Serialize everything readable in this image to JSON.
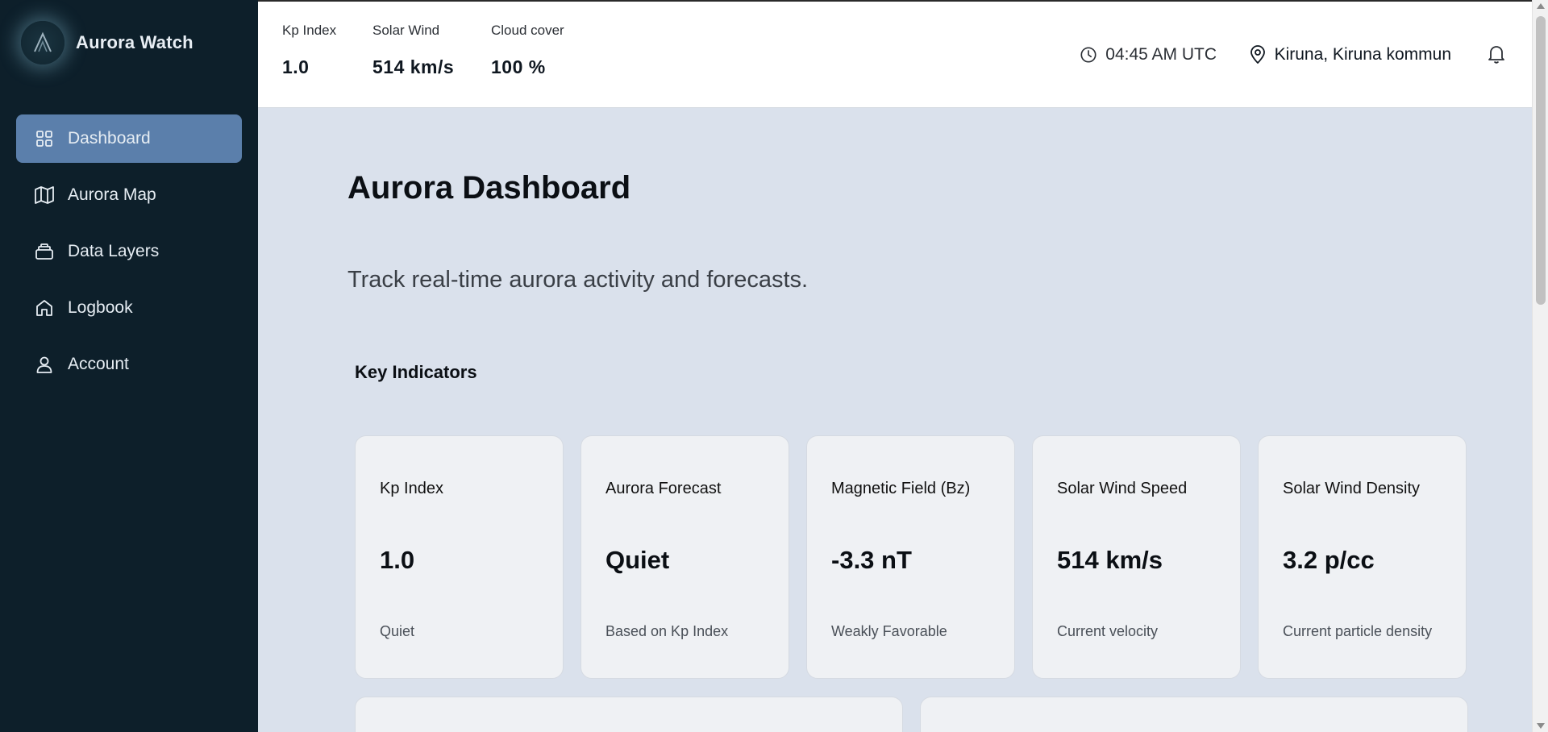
{
  "app": {
    "name": "Aurora Watch"
  },
  "sidebar": {
    "items": [
      {
        "label": "Dashboard",
        "icon": "grid-icon",
        "active": true
      },
      {
        "label": "Aurora Map",
        "icon": "map-icon",
        "active": false
      },
      {
        "label": "Data Layers",
        "icon": "layers-icon",
        "active": false
      },
      {
        "label": "Logbook",
        "icon": "home-icon",
        "active": false
      },
      {
        "label": "Account",
        "icon": "user-icon",
        "active": false
      }
    ]
  },
  "topbar": {
    "stats": [
      {
        "label": "Kp Index",
        "value": "1.0"
      },
      {
        "label": "Solar Wind",
        "value": "514 km/s"
      },
      {
        "label": "Cloud cover",
        "value": "100 %"
      }
    ],
    "time": "04:45 AM UTC",
    "location": "Kiruna, Kiruna kommun"
  },
  "main": {
    "title": "Aurora Dashboard",
    "subtitle": "Track real-time aurora activity and forecasts.",
    "section_title": "Key Indicators",
    "cards": [
      {
        "title": "Kp Index",
        "value": "1.0",
        "caption": "Quiet"
      },
      {
        "title": "Aurora Forecast",
        "value": "Quiet",
        "caption": "Based on Kp Index"
      },
      {
        "title": "Magnetic Field (Bz)",
        "value": "-3.3 nT",
        "caption": "Weakly Favorable"
      },
      {
        "title": "Solar Wind Speed",
        "value": "514 km/s",
        "caption": "Current velocity"
      },
      {
        "title": "Solar Wind Density",
        "value": "3.2 p/cc",
        "caption": "Current particle density"
      }
    ]
  },
  "colors": {
    "sidebar_bg": "#0d1f2a",
    "active_nav": "#5b7fab",
    "page_bg": "#dae1ec",
    "card_bg": "#eff1f4"
  }
}
